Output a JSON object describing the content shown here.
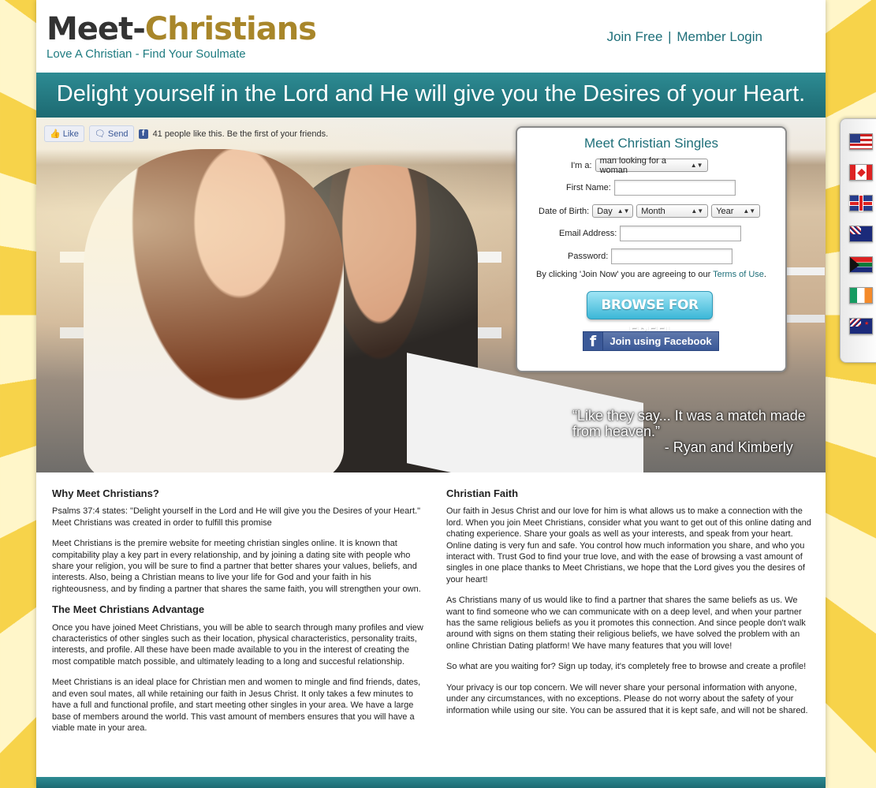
{
  "header": {
    "logo_meet": "Meet",
    "logo_dash": "-",
    "logo_christians": "Christians",
    "tagline": "Love A Christian - Find Your Soulmate",
    "join_free": "Join Free",
    "separator": "|",
    "member_login": "Member Login"
  },
  "banner": {
    "text": "Delight yourself in the Lord and He will give you the Desires of your Heart."
  },
  "facebook_bar": {
    "like_label": "Like",
    "send_label": "Send",
    "count_text": "41 people like this. Be the first of your friends."
  },
  "signup": {
    "title": "Meet Christian Singles",
    "im_a_label": "I'm a:",
    "im_a_value": "man looking for a woman",
    "first_name_label": "First Name:",
    "dob_label": "Date of Birth:",
    "day_value": "Day",
    "month_value": "Month",
    "year_value": "Year",
    "email_label": "Email Address:",
    "password_label": "Password:",
    "terms_prefix": "By clicking 'Join Now' you are agreeing to our",
    "terms_link": "Terms of Use",
    "terms_suffix": ".",
    "browse_button": "BROWSE FOR FREE!",
    "facebook_button": "Join using Facebook"
  },
  "quote": {
    "line1": "“Like they say... It was a match made",
    "line2": "from heaven.”",
    "author": "- Ryan and Kimberly"
  },
  "left_column": {
    "heading1": "Why Meet Christians?",
    "p1": "Psalms 37:4 states: \"Delight yourself in the Lord and He will give you the Desires of your Heart.\" Meet Christians was created in order to fulfill this promise",
    "p2": "Meet Christians is the premire website for meeting christian singles online. It is known that compitability play a key part in every relationship, and by joining a dating site with people who share your religion, you will be sure to find a partner that better shares your values, beliefs, and interests. Also, being a Christian means to live your life for God and your faith in his righteousness, and by finding a partner that shares the same faith, you will strengthen your own.",
    "heading2": "The Meet Christians Advantage",
    "p3": "Once you have joined Meet Christians, you will be able to search through many profiles and view characteristics of other singles such as their location, physical characteristics, personality traits, interests, and profile. All these have been made available to you in the interest of creating the most compatible match possible, and ultimately leading to a long and succesful relationship.",
    "p4": "Meet Christians is an ideal place for Christian men and women to mingle and find friends, dates, and even soul mates, all while retaining our faith in Jesus Christ. It only takes a few minutes to have a full and functional profile, and start meeting other singles in your area. We have a large base of members around the world. This vast amount of members ensures that you will have a viable mate in your area."
  },
  "right_column": {
    "heading": "Christian Faith",
    "p1": "Our faith in Jesus Christ and our love for him is what allows us to make a connection with the lord. When you join Meet Christians, consider what you want to get out of this online dating and chating experience. Share your goals as well as your interests, and speak from your heart. Online dating is very fun and safe. You control how much information you share, and who you interact with. Trust God to find your true love, and with the ease of browsing a vast amount of singles in one place thanks to Meet Christians, we hope that the Lord gives you the desires of your heart!",
    "p2": "As Christians many of us would like to find a partner that shares the same beliefs as us. We want to find someone who we can communicate with on a deep level, and when your partner has the same religious beliefs as you it promotes this connection. And since people don't walk around with signs on them stating their religious beliefs, we have solved the problem with an online Christian Dating platform! We have many features that you will love!",
    "p3": "So what are you waiting for? Sign up today, it's completely free to browse and create a profile!",
    "p4": "Your privacy is our top concern. We will never share your personal information with anyone, under any circumstances, with no exceptions. Please do not worry about the safety of your information while using our site. You can be assured that it is kept safe, and will not be shared."
  },
  "flags": [
    "us-flag-icon",
    "canada-flag-icon",
    "uk-flag-icon",
    "australia-flag-icon",
    "south-africa-flag-icon",
    "ireland-flag-icon",
    "new-zealand-flag-icon"
  ],
  "colors": {
    "teal": "#1e6f79",
    "banner": "#2d8b93",
    "gold": "#a8862a"
  }
}
